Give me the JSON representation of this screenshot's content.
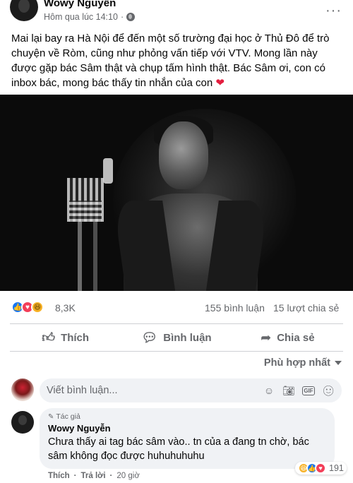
{
  "post": {
    "author": "Wowy Nguyễn",
    "timestamp": "Hôm qua lúc 14:10",
    "dot": "·",
    "more": "···",
    "text": "Mai lại bay ra Hà Nội để đến một số trường đại học ở Thủ Đô để trò chuyện về Ròm, cũng như phỏng vấn tiếp với VTV. Mong lần này được gặp bác Sâm thật và chụp tấm hình thật. Bác Sâm ơi, con có inbox bác, mong bác thấy tin nhắn của con",
    "heart": "❤"
  },
  "stats": {
    "reactions_count": "8,3K",
    "comments": "155 bình luận",
    "shares": "15 lượt chia sẻ"
  },
  "actions": {
    "like": "Thích",
    "comment": "Bình luận",
    "share": "Chia sẻ"
  },
  "sort": {
    "label": "Phù hợp nhất"
  },
  "composer": {
    "placeholder": "Viết bình luận..."
  },
  "comment": {
    "tag": "Tác giả",
    "author": "Wowy Nguyễn",
    "text": "Chưa thấy ai tag bác sâm vào.. tn của a đang tn chờ, bác sâm không đọc được huhuhuhuhu",
    "reaction_count": "191",
    "like": "Thích",
    "reply": "Trả lời",
    "time": "20 giờ",
    "sep": "·"
  },
  "colors": {
    "accent": "#1877f2",
    "love": "#f33e58",
    "haha": "#f7b125",
    "muted": "#65676b"
  }
}
